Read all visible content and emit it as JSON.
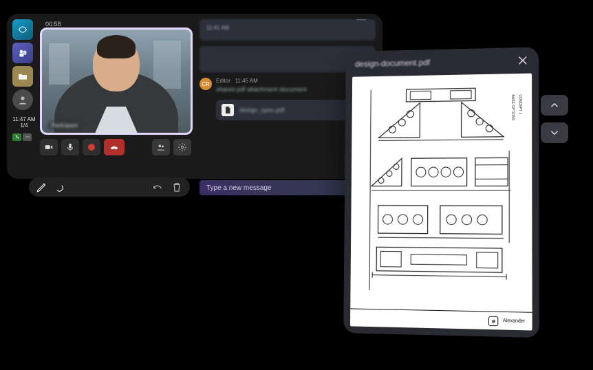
{
  "dock": {
    "time": "11:47 AM",
    "day": "1/4"
  },
  "video": {
    "elapsed": "00:58",
    "name": "Participant"
  },
  "chat": {
    "msg1_time": "11:41 AM",
    "msg2_meta_name": "Editor",
    "msg2_meta_time": "11:45 AM",
    "msg2_body": "shared pdf attachment document",
    "attachment": "design_spec.pdf",
    "avatar_initials": "CR"
  },
  "composer": {
    "placeholder": "Type a new message"
  },
  "pdf": {
    "title_blur": "design-document",
    "ext": ".pdf",
    "concept_label": "CONCEPT 1",
    "base_label": "BASE OPTIONS",
    "titleblock_brand": "Alexander"
  }
}
